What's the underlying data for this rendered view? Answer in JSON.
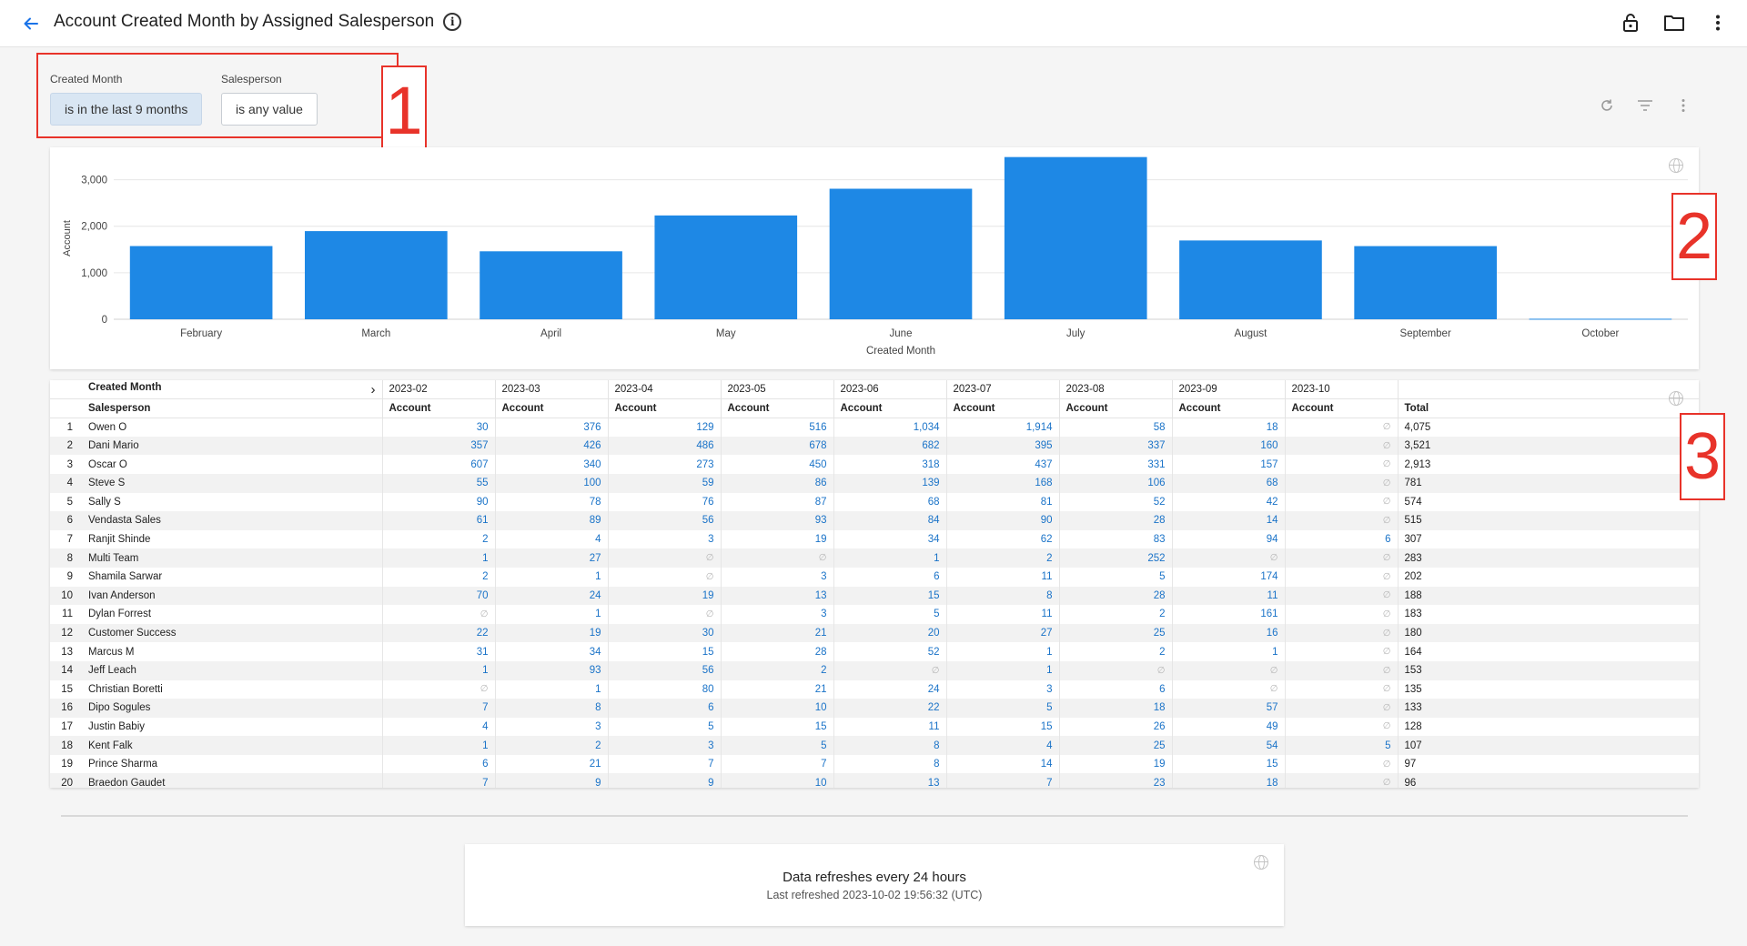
{
  "header": {
    "title": "Account Created Month by Assigned Salesperson",
    "info_icon": "info-icon",
    "icons": [
      "lock-open-icon",
      "folder-icon",
      "more-vertical-icon"
    ]
  },
  "filters": {
    "created_month": {
      "label": "Created Month",
      "value": "is in the last 9 months"
    },
    "salesperson": {
      "label": "Salesperson",
      "value": "is any value"
    }
  },
  "annotations": [
    "1",
    "2",
    "3"
  ],
  "chart_data": {
    "type": "bar",
    "categories": [
      "February",
      "March",
      "April",
      "May",
      "June",
      "July",
      "August",
      "September",
      "October"
    ],
    "values": [
      1574,
      1895,
      1461,
      2232,
      2806,
      3487,
      1694,
      1573,
      11
    ],
    "xlabel": "Created Month",
    "ylabel": "Account",
    "ylim": [
      0,
      3500
    ],
    "yticks": [
      "0",
      "1,000",
      "2,000",
      "3,000"
    ],
    "color": "#1e88e5",
    "grid": true
  },
  "table": {
    "pivot_header_label": "Created Month",
    "row_header_label": "Salesperson",
    "months": [
      "2023-02",
      "2023-03",
      "2023-04",
      "2023-05",
      "2023-06",
      "2023-07",
      "2023-08",
      "2023-09",
      "2023-10"
    ],
    "measure_label": "Account",
    "total_label": "Total",
    "null_symbol": "∅",
    "rows": [
      {
        "idx": "1",
        "name": "Owen O",
        "vals": [
          "30",
          "376",
          "129",
          "516",
          "1,034",
          "1,914",
          "58",
          "18",
          null
        ],
        "total": "4,075"
      },
      {
        "idx": "2",
        "name": "Dani Mario",
        "vals": [
          "357",
          "426",
          "486",
          "678",
          "682",
          "395",
          "337",
          "160",
          null
        ],
        "total": "3,521"
      },
      {
        "idx": "3",
        "name": "Oscar O",
        "vals": [
          "607",
          "340",
          "273",
          "450",
          "318",
          "437",
          "331",
          "157",
          null
        ],
        "total": "2,913"
      },
      {
        "idx": "4",
        "name": "Steve S",
        "vals": [
          "55",
          "100",
          "59",
          "86",
          "139",
          "168",
          "106",
          "68",
          null
        ],
        "total": "781"
      },
      {
        "idx": "5",
        "name": "Sally S",
        "vals": [
          "90",
          "78",
          "76",
          "87",
          "68",
          "81",
          "52",
          "42",
          null
        ],
        "total": "574"
      },
      {
        "idx": "6",
        "name": "Vendasta Sales",
        "vals": [
          "61",
          "89",
          "56",
          "93",
          "84",
          "90",
          "28",
          "14",
          null
        ],
        "total": "515"
      },
      {
        "idx": "7",
        "name": "Ranjit Shinde",
        "vals": [
          "2",
          "4",
          "3",
          "19",
          "34",
          "62",
          "83",
          "94",
          "6"
        ],
        "total": "307"
      },
      {
        "idx": "8",
        "name": "Multi Team",
        "vals": [
          "1",
          "27",
          null,
          null,
          "1",
          "2",
          "252",
          null,
          null
        ],
        "total": "283"
      },
      {
        "idx": "9",
        "name": "Shamila Sarwar",
        "vals": [
          "2",
          "1",
          null,
          "3",
          "6",
          "11",
          "5",
          "174",
          null
        ],
        "total": "202"
      },
      {
        "idx": "10",
        "name": "Ivan Anderson",
        "vals": [
          "70",
          "24",
          "19",
          "13",
          "15",
          "8",
          "28",
          "11",
          null
        ],
        "total": "188"
      },
      {
        "idx": "11",
        "name": "Dylan Forrest",
        "vals": [
          null,
          "1",
          null,
          "3",
          "5",
          "11",
          "2",
          "161",
          null
        ],
        "total": "183"
      },
      {
        "idx": "12",
        "name": "Customer Success",
        "vals": [
          "22",
          "19",
          "30",
          "21",
          "20",
          "27",
          "25",
          "16",
          null
        ],
        "total": "180"
      },
      {
        "idx": "13",
        "name": "Marcus M",
        "vals": [
          "31",
          "34",
          "15",
          "28",
          "52",
          "1",
          "2",
          "1",
          null
        ],
        "total": "164"
      },
      {
        "idx": "14",
        "name": "Jeff Leach",
        "vals": [
          "1",
          "93",
          "56",
          "2",
          null,
          "1",
          null,
          null,
          null
        ],
        "total": "153"
      },
      {
        "idx": "15",
        "name": "Christian Boretti",
        "vals": [
          null,
          "1",
          "80",
          "21",
          "24",
          "3",
          "6",
          null,
          null
        ],
        "total": "135"
      },
      {
        "idx": "16",
        "name": "Dipo Sogules",
        "vals": [
          "7",
          "8",
          "6",
          "10",
          "22",
          "5",
          "18",
          "57",
          null
        ],
        "total": "133"
      },
      {
        "idx": "17",
        "name": "Justin Babiy",
        "vals": [
          "4",
          "3",
          "5",
          "15",
          "11",
          "15",
          "26",
          "49",
          null
        ],
        "total": "128"
      },
      {
        "idx": "18",
        "name": "Kent Falk",
        "vals": [
          "1",
          "2",
          "3",
          "5",
          "8",
          "4",
          "25",
          "54",
          "5"
        ],
        "total": "107"
      },
      {
        "idx": "19",
        "name": "Prince Sharma",
        "vals": [
          "6",
          "21",
          "7",
          "7",
          "8",
          "14",
          "19",
          "15",
          null
        ],
        "total": "97"
      },
      {
        "idx": "20",
        "name": "Braedon Gaudet",
        "vals": [
          "7",
          "9",
          "9",
          "10",
          "13",
          "7",
          "23",
          "18",
          null
        ],
        "total": "96"
      }
    ]
  },
  "footer": {
    "refresh_text": "Data refreshes every 24 hours",
    "last_refreshed": "Last refreshed 2023-10-02 19:56:32 (UTC)"
  }
}
